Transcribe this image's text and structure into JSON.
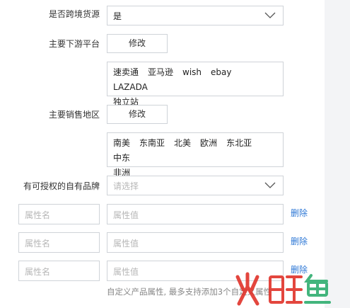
{
  "cross_border": {
    "label": "是否跨境货源",
    "value": "是"
  },
  "platforms": {
    "label": "主要下游平台",
    "button": "修改",
    "items": [
      "速卖通",
      "亚马逊",
      "wish",
      "ebay",
      "LAZADA",
      "独立站"
    ]
  },
  "regions": {
    "label": "主要销售地区",
    "button": "修改",
    "items": [
      "南美",
      "东南亚",
      "北美",
      "欧洲",
      "东北亚",
      "中东",
      "非洲"
    ]
  },
  "brand": {
    "label": "有可授权的自有品牌",
    "placeholder": "请选择"
  },
  "attributes": {
    "rows": [
      {
        "name_placeholder": "属性名",
        "value_placeholder": "属性值",
        "delete_label": "删除"
      },
      {
        "name_placeholder": "属性名",
        "value_placeholder": "属性值",
        "delete_label": "删除"
      },
      {
        "name_placeholder": "属性名",
        "value_placeholder": "属性值",
        "delete_label": "删除"
      }
    ],
    "hint": "自定义产品属性, 最多支持添加3个自定义属性"
  },
  "colors": {
    "link": "#2e78d6",
    "border": "#cfd3d8",
    "watermark": "#e0332a"
  }
}
